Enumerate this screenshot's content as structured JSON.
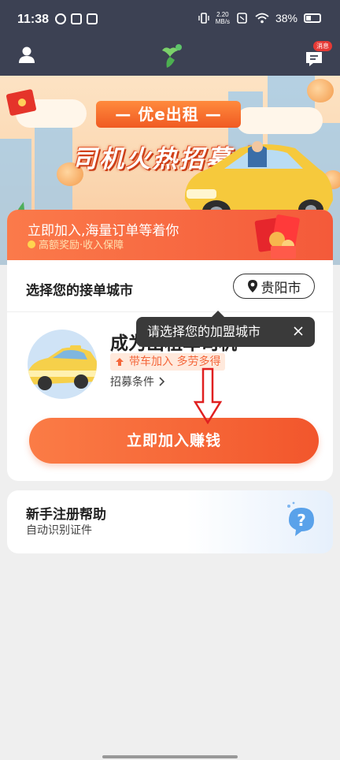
{
  "status_bar": {
    "time": "11:38",
    "net_speed_value": "2.20",
    "net_speed_unit": "MB/s",
    "battery": "38%"
  },
  "app_bar": {
    "message_badge": "消息",
    "icons": [
      "user-icon",
      "app-logo",
      "message-icon"
    ]
  },
  "banner": {
    "pill_text": "— 优e出租 —",
    "headline": "司机火热招募中"
  },
  "card": {
    "promo_line1": "立即加入,海量订单等着你",
    "promo_line2": "高额奖励·收入保障",
    "city_label": "选择您的接单城市",
    "city_value": "贵阳市",
    "driver_title": "成为出租车司机",
    "driver_badge": "带车加入 多劳多得",
    "conditions_link": "招募条件",
    "join_button": "立即加入赚钱"
  },
  "tooltip": {
    "text": "请选择您的加盟城市"
  },
  "help": {
    "title": "新手注册帮助",
    "subtitle": "自动识别证件"
  },
  "colors": {
    "accent": "#f45a3a",
    "topbar": "#3c4153",
    "tooltip": "#3a3a3a",
    "annotation_arrow": "#e02020"
  }
}
